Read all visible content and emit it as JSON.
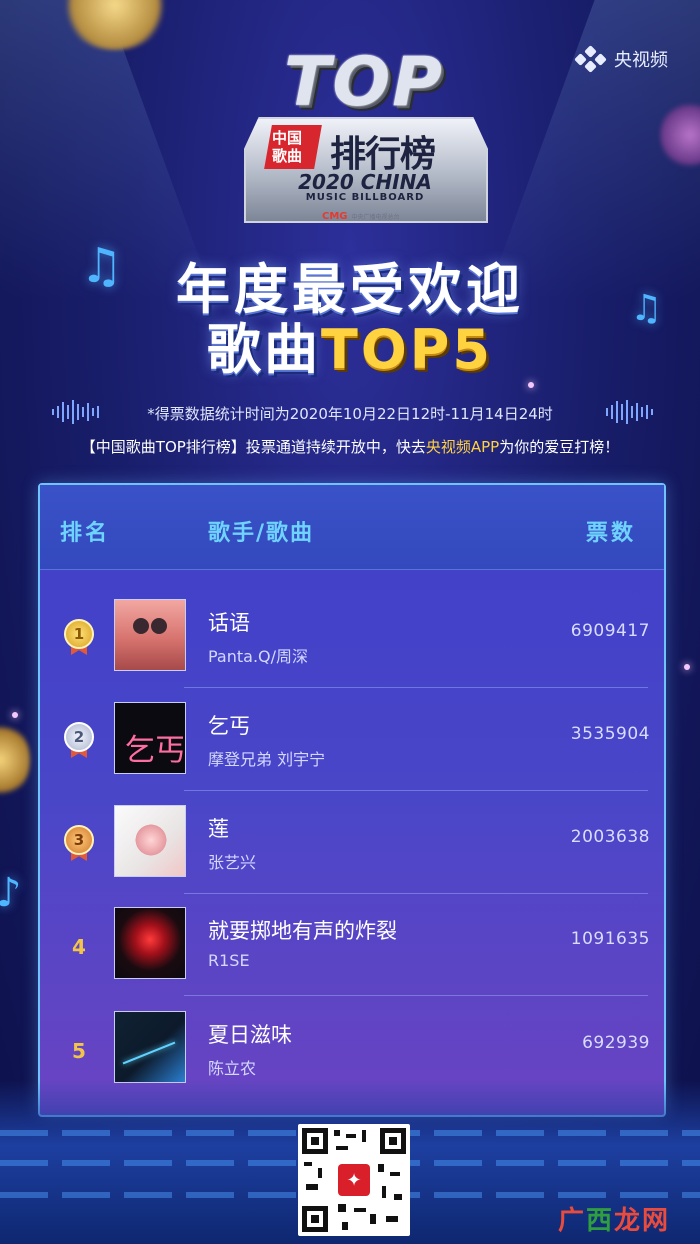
{
  "brand": {
    "name": "央视频"
  },
  "logo": {
    "top": "TOP",
    "cn_small": "中国歌曲",
    "cn_big": "排行榜",
    "line1": "2020 CHINA",
    "line2": "MUSIC BILLBOARD",
    "foot": "CMG",
    "foot_sub": "中央广播电视总台"
  },
  "headline": {
    "line1": "年度最受欢迎",
    "line2_prefix": "歌曲",
    "line2_accent": "TOP5"
  },
  "subtitle1": "*得票数据统计时间为2020年10月22日12时-11月14日24时",
  "subtitle2": {
    "prefix": "【中国歌曲TOP排行榜】投票通道持续开放中，快去",
    "highlight": "央视频APP",
    "suffix": "为你的爱豆打榜！"
  },
  "table": {
    "col_rank": "排名",
    "col_song": "歌手/歌曲",
    "col_votes": "票数",
    "rows": [
      {
        "rank": "1",
        "song": "话语",
        "artist": "Panta.Q/周深",
        "votes": "6909417"
      },
      {
        "rank": "2",
        "song": "乞丐",
        "artist": "摩登兄弟 刘宇宁",
        "votes": "3535904"
      },
      {
        "rank": "3",
        "song": "莲",
        "artist": "张艺兴",
        "votes": "2003638"
      },
      {
        "rank": "4",
        "song": "就要掷地有声的炸裂",
        "artist": "R1SE",
        "votes": "1091635"
      },
      {
        "rank": "5",
        "song": "夏日滋味",
        "artist": "陈立农",
        "votes": "692939"
      }
    ]
  },
  "watermark": {
    "a": "广",
    "b": "西",
    "c": "龙网"
  },
  "colors": {
    "accent": "#ffd23f",
    "header_text": "#6fd3ff",
    "card_border": "#6fc4ff"
  }
}
